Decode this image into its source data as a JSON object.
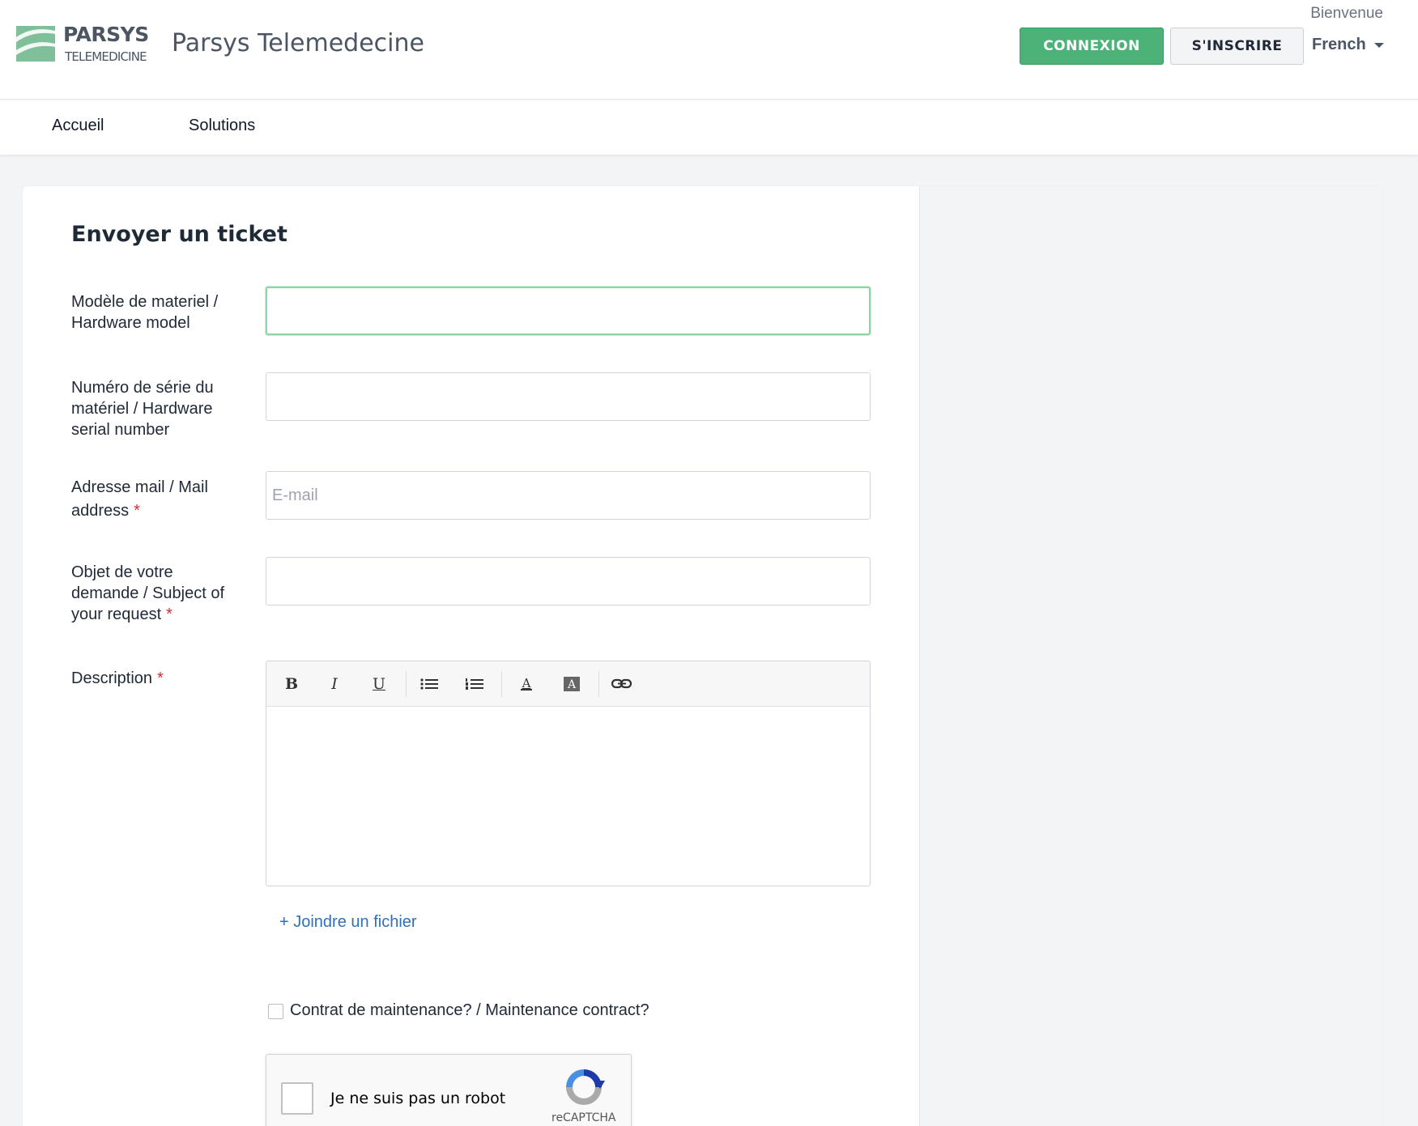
{
  "header": {
    "logo_name": "PARSYS",
    "logo_sub": "TELEMEDICINE",
    "site_title": "Parsys Telemedecine",
    "welcome": "Bienvenue",
    "login_label": "CONNEXION",
    "signup_label": "S'INSCRIRE",
    "language": "French"
  },
  "nav": {
    "items": [
      {
        "label": "Accueil"
      },
      {
        "label": "Solutions"
      }
    ]
  },
  "form": {
    "title": "Envoyer un ticket",
    "fields": [
      {
        "label": "Modèle de materiel / Hardware model",
        "value": "",
        "placeholder": "",
        "required": false
      },
      {
        "label": "Numéro de série du matériel / Hardware serial number",
        "value": "",
        "placeholder": "",
        "required": false
      },
      {
        "label": "Adresse mail / Mail address",
        "value": "",
        "placeholder": "E-mail",
        "required": true
      },
      {
        "label": "Objet de votre demande / Subject of your request",
        "value": "",
        "placeholder": "",
        "required": true
      }
    ],
    "description_label": "Description",
    "required_marker": "*",
    "toolbar": [
      "bold",
      "italic",
      "underline",
      "bullet-list",
      "numbered-list",
      "text-color",
      "background-color",
      "link"
    ],
    "attach_label": "+ Joindre un fichier",
    "maintenance_label": "Contrat de maintenance? / Maintenance contract?",
    "maintenance_checked": false
  },
  "captcha": {
    "label": "Je ne suis pas un robot",
    "brand": "reCAPTCHA"
  },
  "colors": {
    "accent_green": "#4db277",
    "link_blue": "#2f6fbf",
    "required_red": "#d32f2f"
  }
}
